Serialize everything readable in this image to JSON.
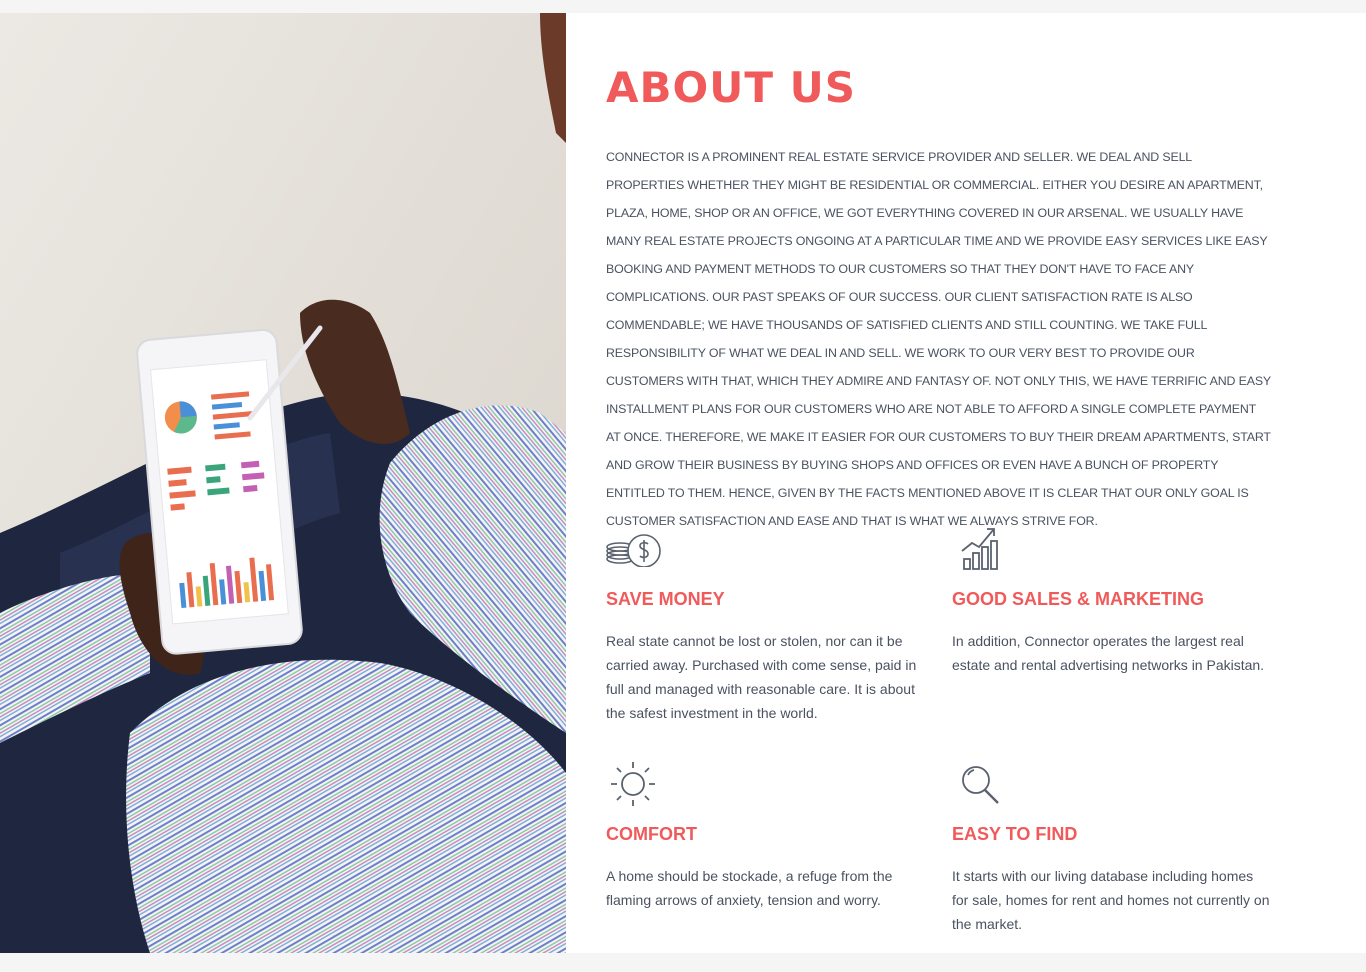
{
  "about": {
    "title": "ABOUT US",
    "body": "CONNECTOR IS A PROMINENT REAL ESTATE SERVICE PROVIDER AND SELLER. WE DEAL AND SELL PROPERTIES WHETHER THEY MIGHT BE RESIDENTIAL OR COMMERCIAL. EITHER YOU DESIRE AN APARTMENT, PLAZA, HOME, SHOP OR AN OFFICE, WE GOT EVERYTHING COVERED IN OUR ARSENAL. WE USUALLY HAVE MANY REAL ESTATE PROJECTS ONGOING AT A PARTICULAR TIME AND WE PROVIDE EASY SERVICES LIKE EASY BOOKING AND PAYMENT METHODS TO OUR CUSTOMERS SO THAT THEY DON'T HAVE TO FACE ANY COMPLICATIONS. OUR PAST SPEAKS OF OUR SUCCESS. OUR CLIENT SATISFACTION RATE IS ALSO COMMENDABLE; WE HAVE THOUSANDS OF SATISFIED CLIENTS AND STILL COUNTING. WE TAKE FULL RESPONSIBILITY OF WHAT WE DEAL IN AND SELL. WE WORK TO OUR VERY BEST TO PROVIDE OUR CUSTOMERS WITH THAT, WHICH THEY ADMIRE AND FANTASY OF. NOT ONLY THIS, WE HAVE TERRIFIC AND EASY INSTALLMENT PLANS FOR OUR CUSTOMERS WHO ARE NOT ABLE TO AFFORD A SINGLE COMPLETE PAYMENT AT ONCE. THEREFORE, WE MAKE IT EASIER FOR OUR CUSTOMERS TO BUY THEIR DREAM APARTMENTS, START AND GROW THEIR BUSINESS BY BUYING SHOPS AND OFFICES OR EVEN HAVE A BUNCH OF PROPERTY ENTITLED TO THEM. HENCE, GIVEN BY THE FACTS MENTIONED ABOVE IT IS CLEAR THAT OUR ONLY GOAL IS CUSTOMER SATISFACTION AND EASE AND THAT IS WHAT WE ALWAYS STRIVE FOR."
  },
  "features": [
    {
      "icon": "money-icon",
      "title": "SAVE MONEY",
      "text": "Real state cannot be lost or stolen, nor can it be carried away. Purchased with come sense, paid in full and managed with reasonable care. It is about the safest investment in the world."
    },
    {
      "icon": "growth-chart-icon",
      "title": "GOOD SALES & MARKETING",
      "text": "In addition, Connector operates the largest real estate and rental advertising networks in Pakistan."
    },
    {
      "icon": "sun-icon",
      "title": "COMFORT",
      "text": "A home should be stockade, a refuge from the flaming arrows of anxiety, tension and worry."
    },
    {
      "icon": "search-icon",
      "title": "EASY TO FIND",
      "text": "It starts with our living database including homes for sale, homes for rent and homes not currently on the market."
    }
  ],
  "colors": {
    "accent": "#f05a5a",
    "text": "#4a5260",
    "icon": "#5a6270"
  }
}
